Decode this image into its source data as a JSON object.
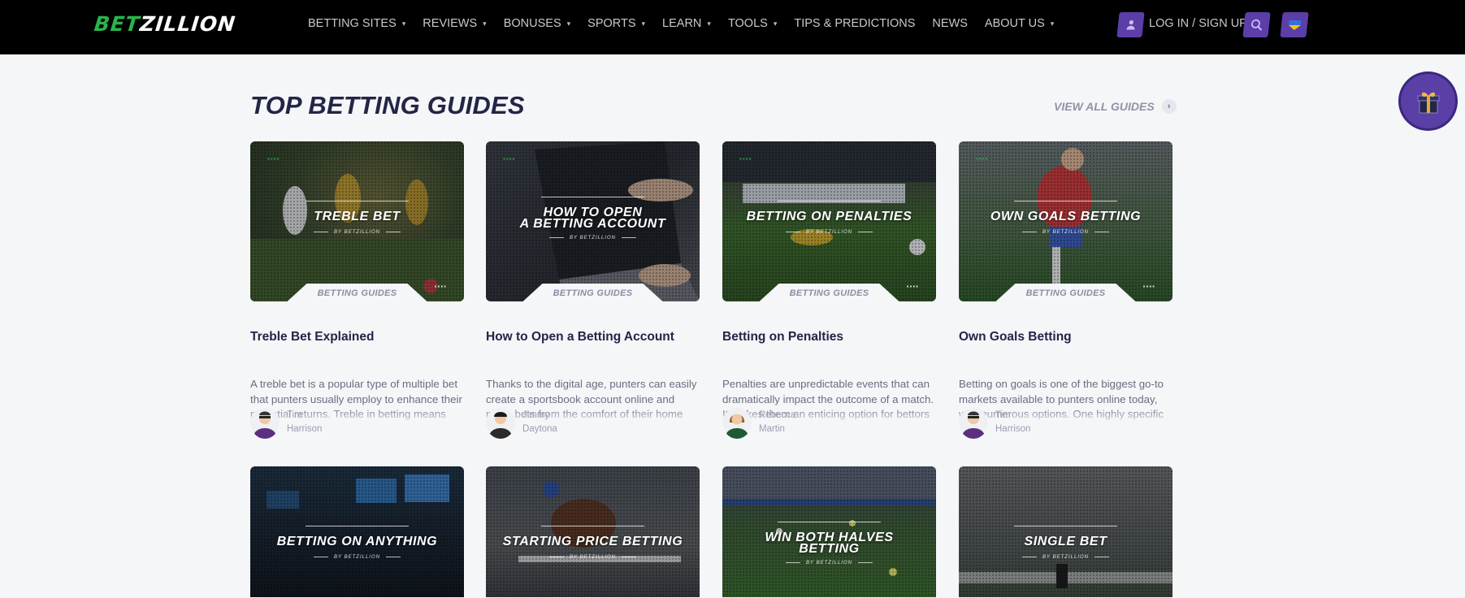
{
  "header": {
    "logo_part1": "BET",
    "logo_part2": "ZILLION",
    "nav": [
      {
        "label": "BETTING SITES",
        "has_dropdown": true
      },
      {
        "label": "REVIEWS",
        "has_dropdown": true
      },
      {
        "label": "BONUSES",
        "has_dropdown": true
      },
      {
        "label": "SPORTS",
        "has_dropdown": true
      },
      {
        "label": "LEARN",
        "has_dropdown": true
      },
      {
        "label": "TOOLS",
        "has_dropdown": true
      },
      {
        "label": "TIPS & PREDICTIONS",
        "has_dropdown": false
      },
      {
        "label": "NEWS",
        "has_dropdown": false
      },
      {
        "label": "ABOUT US",
        "has_dropdown": true
      }
    ],
    "login_label": "LOG IN / SIGN UP",
    "login_icon": "user-icon",
    "search_icon": "search-icon",
    "language_icon": "ukraine-flag-icon"
  },
  "floating": {
    "gift_icon": "gift-icon"
  },
  "section": {
    "title": "TOP BETTING GUIDES",
    "view_all": "VIEW ALL GUIDES"
  },
  "colors": {
    "brand_green": "#2bb34a",
    "accent_purple": "#5b3ea8",
    "heading": "#232547",
    "background": "#f5f6f8"
  },
  "cards": [
    {
      "image_title_line1": "TREBLE BET",
      "image_title_line2": "",
      "image_byline": "BY BETZILLION",
      "tag": "BETTING GUIDES",
      "title": "Treble Bet Explained",
      "description": "A treble bet is a popular type of multiple bet that punters usually employ to enhance their potential returns. Treble in betting means",
      "author_first": "Tim",
      "author_last": "Harrison"
    },
    {
      "image_title_line1": "HOW TO OPEN",
      "image_title_line2": "A BETTING ACCOUNT",
      "image_byline": "BY BETZILLION",
      "tag": "BETTING GUIDES",
      "title": "How to Open a Betting Account",
      "description": "Thanks to the digital age, punters can easily create a sportsbook account online and place bets from the comfort of their home",
      "author_first": "Jimmy",
      "author_last": "Daytona"
    },
    {
      "image_title_line1": "BETTING ON PENALTIES",
      "image_title_line2": "",
      "image_byline": "BY BETZILLION",
      "tag": "BETTING GUIDES",
      "title": "Betting on Penalties",
      "description": "Penalties are unpredictable events that can dramatically impact the outcome of a match. It makes them an enticing option for bettors",
      "author_first": "Rebecca",
      "author_last": "Martin"
    },
    {
      "image_title_line1": "OWN GOALS BETTING",
      "image_title_line2": "",
      "image_byline": "BY BETZILLION",
      "tag": "BETTING GUIDES",
      "title": "Own Goals Betting",
      "description": "Betting on goals is one of the biggest go-to markets available to punters online today, with numerous options. One highly specific",
      "author_first": "Tim",
      "author_last": "Harrison"
    },
    {
      "image_title_line1": "BETTING ON ANYTHING",
      "image_title_line2": "",
      "image_byline": "BY BETZILLION"
    },
    {
      "image_title_line1": "STARTING PRICE BETTING",
      "image_title_line2": "",
      "image_byline": "BY BETZILLION"
    },
    {
      "image_title_line1": "WIN BOTH HALVES",
      "image_title_line2": "BETTING",
      "image_byline": "BY BETZILLION"
    },
    {
      "image_title_line1": "SINGLE BET",
      "image_title_line2": "",
      "image_byline": "BY BETZILLION"
    }
  ]
}
